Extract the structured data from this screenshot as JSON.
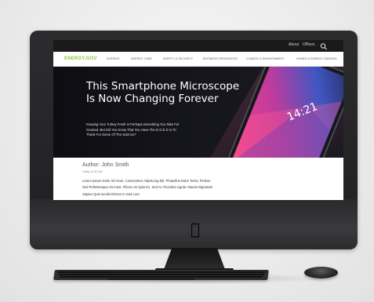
{
  "topbar": {
    "links": [
      "About",
      "Offices"
    ],
    "search_icon": "search-icon"
  },
  "nav": {
    "logo": "ENERGY.GOV",
    "items": [
      "SCIENCE",
      "ENERGY JOBS",
      "SAFETY & SECURITY",
      "BUSINESS RESOURCES",
      "CLIMATE & ENVIRONMENT",
      "HOMES & ENERGY SAVINGS"
    ]
  },
  "hero": {
    "title_line1": "This Smartphone Microscope",
    "title_line2": "Is Now  Changing Forever",
    "subtitle_line1": "Keeping Your Turkey Fresh Is Perhaps Something You Take For",
    "subtitle_line2": "Granted, But Did You Know That You Have The D.O.E.D Is To",
    "subtitle_line3": "Thank For Some Of The Science?",
    "phone_time": "14:21"
  },
  "article": {
    "author": "Author: John Smith",
    "date": "Today 11:32 AM",
    "body_lines": [
      "Lorem Ipsum Dolor Sit Amet, Consectetur Adipiscing Elit. Phasellus Dolor Tortor, Finibus",
      "Sed Pellentesque Sit Amet, Rhonc Us Quis Ex. Sed Ac Tincidunt Ligula. Mauris Dignissim",
      "Sapien Quis Iaculis Dictum In Sed Lore."
    ]
  },
  "device": {
    "logo_icon": "apple-logo-icon"
  },
  "colors": {
    "brand_green": "#8cc63f",
    "hero_bg": "#111116",
    "topbar_bg": "#1a1a1a"
  }
}
